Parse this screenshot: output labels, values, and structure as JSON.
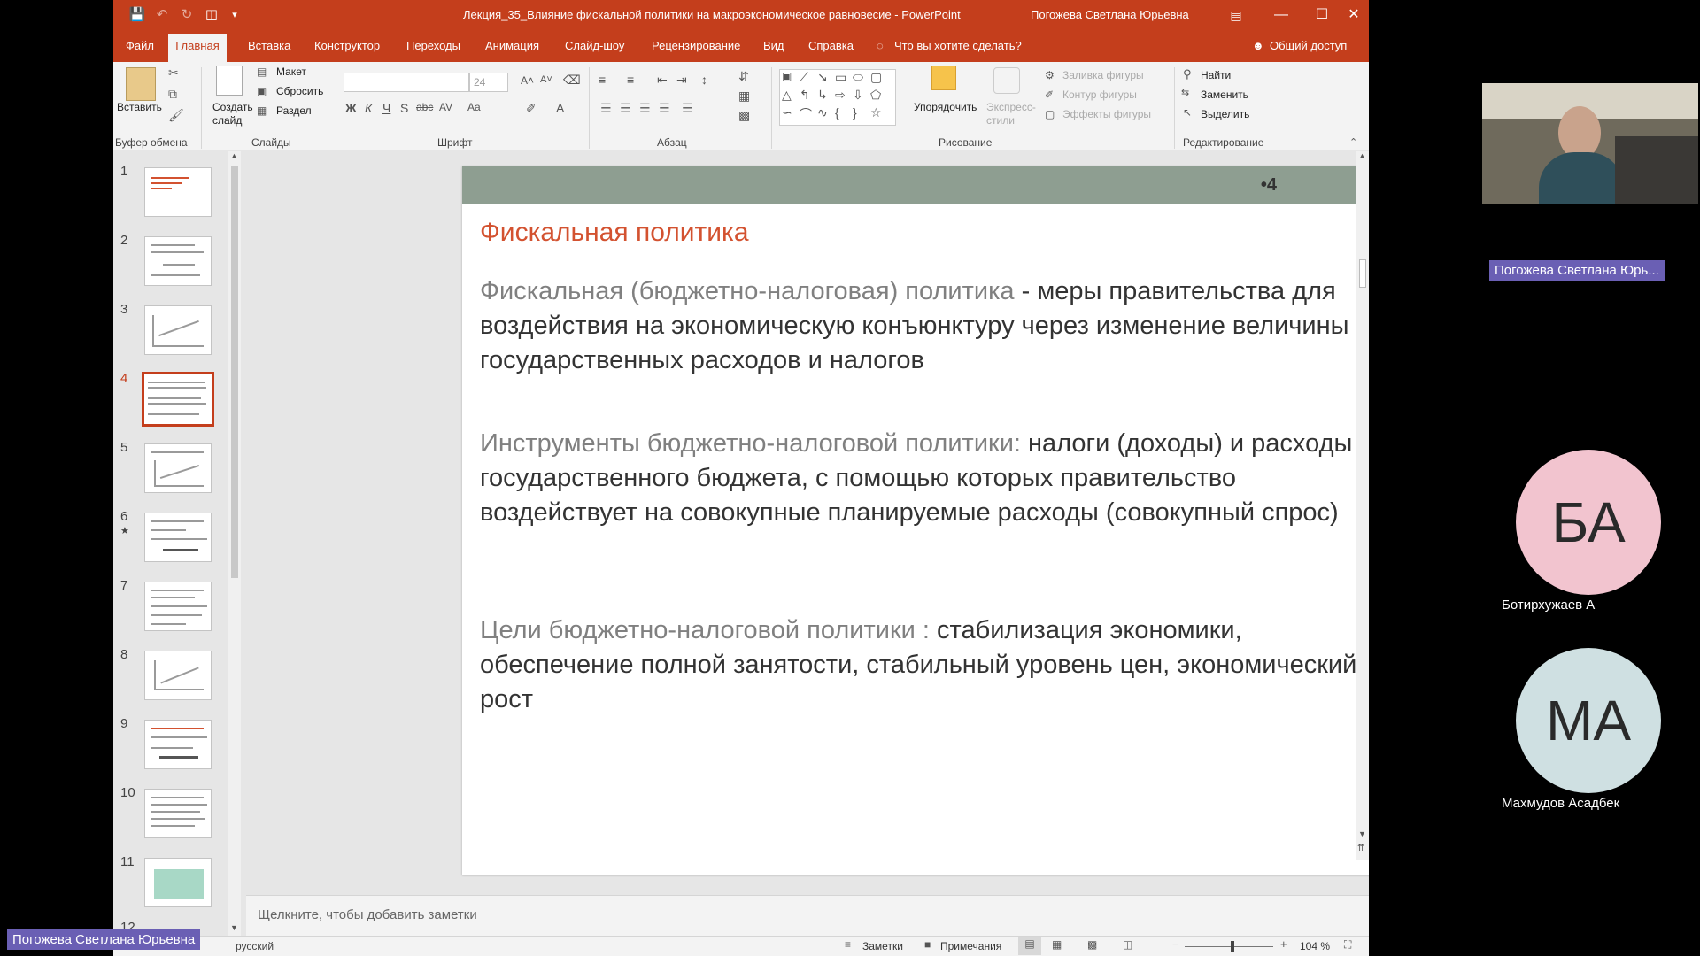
{
  "titlebar": {
    "document_title": "Лекция_35_Влияние фискальной политики на макроэкономическое равновесие - PowerPoint",
    "user": "Погожева Светлана Юрьевна"
  },
  "tabs": [
    "Файл",
    "Главная",
    "Вставка",
    "Конструктор",
    "Переходы",
    "Анимация",
    "Слайд-шоу",
    "Рецензирование",
    "Вид",
    "Справка"
  ],
  "tell_me": "Что вы хотите сделать?",
  "share": "Общий доступ",
  "ribbon": {
    "clipboard": {
      "paste": "Вставить",
      "label": "Буфер обмена"
    },
    "slides": {
      "new_slide": "Создать слайд",
      "layout": "Макет",
      "reset": "Сбросить",
      "section": "Раздел",
      "label": "Слайды"
    },
    "font": {
      "size": "24",
      "label": "Шрифт"
    },
    "paragraph": {
      "label": "Абзац"
    },
    "drawing": {
      "arrange": "Упорядочить",
      "quick_styles": "Экспресс-стили",
      "fill": "Заливка фигуры",
      "outline": "Контур фигуры",
      "effects": "Эффекты фигуры",
      "label": "Рисование"
    },
    "editing": {
      "find": "Найти",
      "replace": "Заменить",
      "select": "Выделить",
      "label": "Редактирование"
    }
  },
  "thumbnails": {
    "numbers": [
      "1",
      "2",
      "3",
      "4",
      "5",
      "6",
      "7",
      "8",
      "9",
      "10",
      "11",
      "12"
    ],
    "active": "4"
  },
  "slide": {
    "number": "•4",
    "title": "Фискальная политика",
    "p1_term": "Фискальная (бюджетно-налоговая) политика",
    "p1_text": " - меры правительства для воздействия на экономическую конъюнктуру через изменение величины государственных расходов и налогов",
    "p2_term": "Инструменты бюджетно-налоговой политики:",
    "p2_text": " налоги (доходы) и расходы государственного бюджета, с помощью которых правительство воздействует на совокупные планируемые расходы (совокупный спрос)",
    "p3_term": "Цели бюджетно-налоговой политики :",
    "p3_text": " стабилизация экономики, обеспечение полной занятости, стабильный уровень цен, экономический рост"
  },
  "notes_placeholder": "Щелкните, чтобы добавить заметки",
  "status": {
    "language": "русский",
    "notes": "Заметки",
    "comments": "Примечания",
    "zoom": "104 %"
  },
  "participants": {
    "presenter": "Погожева Светлана Юрь...",
    "p1_initials": "БА",
    "p1_name": "Ботирхужаев А",
    "p2_initials": "МА",
    "p2_name": "Махмудов Асадбек",
    "bottom_tag": "Погожева Светлана Юрьевна"
  },
  "colors": {
    "ppt_accent": "#c43e1c",
    "slide_title": "#d35230",
    "header_band": "#8e9e91",
    "avatar1": "#f2c4cf",
    "avatar2": "#cfe0e2"
  }
}
